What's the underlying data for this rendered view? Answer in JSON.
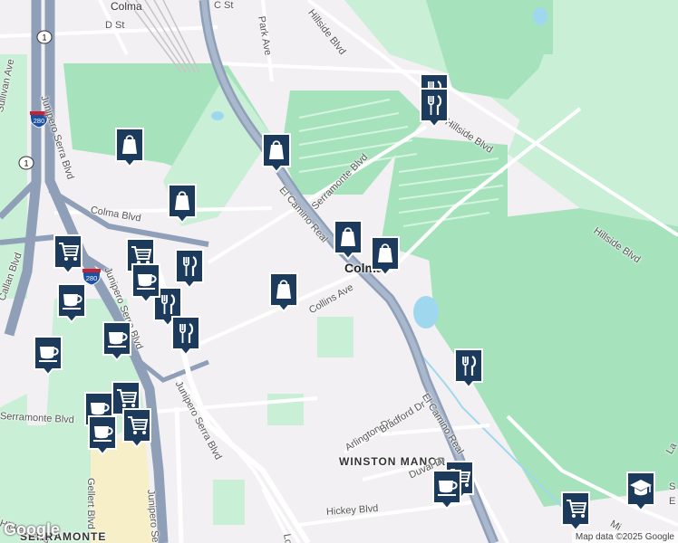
{
  "map": {
    "labels": {
      "colma_top": "Colma",
      "c_st": "C St",
      "d_st": "D St",
      "park_ave": "Park Ave",
      "hillside_top": "Hillside Blvd",
      "hillside_mid": "Hillside Blvd",
      "hillside_right": "Hillside Blvd",
      "sullivan": "Sullivan Ave",
      "junipero_top": "Junipero Serra Blvd",
      "colma_blvd": "Colma Blvd",
      "el_camino_top": "El Camino Real",
      "serramonte_top": "Serramonte Blvd",
      "colma_center": "Colma",
      "callan": "Callan Blvd",
      "junipero_mid": "Junipero Serra Blvd",
      "collins": "Collins Ave",
      "el_camino_bottom": "El Camino Real",
      "serramonte_bottom": "Serramonte Blvd",
      "junipero_bottom": "Junipero Serra Blvd",
      "junipero_lower": "Junipero Se",
      "arlington": "Arlington Dr",
      "bradford": "Bradford Dr",
      "winston_manor": "WINSTON MANOR",
      "duval": "Duval Dr",
      "gellert": "Gellert Blvd",
      "hickey_left": "Hickey Blvd",
      "hickey_right": "Hickey Blvd",
      "serramonte_area": "SERRAMONTE",
      "la_right": "La",
      "mi_right": "Mi",
      "lon": "Lon",
      "s_right": "S",
      "e_right": "E"
    },
    "shields": {
      "route1_top": "1",
      "route1_mid": "1",
      "i280_top": "280",
      "i280_mid": "280"
    },
    "pins": [
      {
        "icon": "shopping-bag-icon"
      },
      {
        "icon": "shopping-bag-icon"
      },
      {
        "icon": "shopping-bag-icon"
      },
      {
        "icon": "shopping-bag-icon"
      },
      {
        "icon": "shopping-bag-icon"
      },
      {
        "icon": "shopping-bag-icon"
      },
      {
        "icon": "restaurant-icon"
      },
      {
        "icon": "restaurant-icon"
      },
      {
        "icon": "restaurant-icon"
      },
      {
        "icon": "restaurant-icon"
      },
      {
        "icon": "restaurant-icon"
      },
      {
        "icon": "restaurant-icon"
      },
      {
        "icon": "shopping-cart-icon"
      },
      {
        "icon": "shopping-cart-icon"
      },
      {
        "icon": "shopping-cart-icon"
      },
      {
        "icon": "shopping-cart-icon"
      },
      {
        "icon": "shopping-cart-icon"
      },
      {
        "icon": "shopping-cart-icon"
      },
      {
        "icon": "coffee-cup-icon"
      },
      {
        "icon": "coffee-cup-icon"
      },
      {
        "icon": "coffee-cup-icon"
      },
      {
        "icon": "coffee-cup-icon"
      },
      {
        "icon": "coffee-cup-icon"
      },
      {
        "icon": "coffee-cup-icon"
      },
      {
        "icon": "coffee-cup-icon"
      },
      {
        "icon": "coffee-cup-icon"
      },
      {
        "icon": "school-icon"
      }
    ],
    "colors": {
      "background": "#f2f0f2",
      "park": "#c9efd6",
      "park_dark": "#a6e3bd",
      "highway": "#8e9fb7",
      "road": "#ffffff",
      "water": "#9fd8ee",
      "pin": "#1b3a5c"
    },
    "logo": "Google",
    "attribution": "Map data ©2025 Google"
  }
}
